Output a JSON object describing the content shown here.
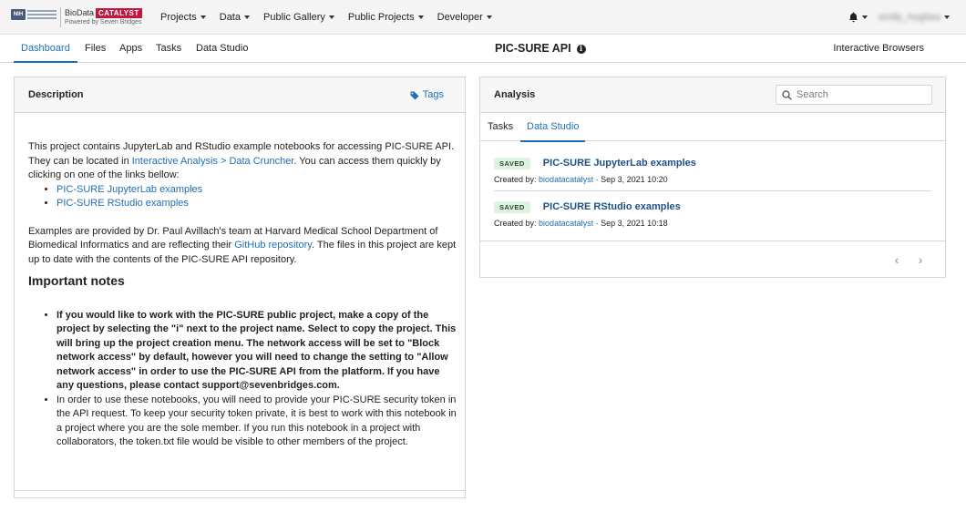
{
  "brand": {
    "nih": "NIH",
    "name_prefix": "BioData",
    "name_highlight": "CATALYST",
    "powered_by": "Powered by Seven Bridges"
  },
  "topnav": {
    "items": [
      "Projects",
      "Data",
      "Public Gallery",
      "Public Projects",
      "Developer"
    ],
    "username": "emily_hughes"
  },
  "subnav": {
    "tabs": [
      "Dashboard",
      "Files",
      "Apps",
      "Tasks",
      "Data Studio"
    ],
    "active_tab": "Dashboard",
    "page_title": "PIC-SURE API",
    "interactive_browsers": "Interactive Browsers"
  },
  "description": {
    "title": "Description",
    "tags_label": "Tags",
    "intro_pre": "This project contains JupyterLab and RStudio example notebooks for accessing PIC-SURE API. They can be located in ",
    "intro_link": "Interactive Analysis > Data Cruncher",
    "intro_post": ". You can access them quickly by clicking on one of the links bellow:",
    "links": [
      "PIC-SURE JupyterLab examples",
      "PIC-SURE RStudio examples"
    ],
    "para2_pre": "Examples are provided by Dr. Paul Avillach's team at Harvard Medical School Department of Biomedical Informatics and are reflecting their ",
    "para2_link": "GitHub repository",
    "para2_post": ". The files in this project are kept up to date with the contents of the PIC-SURE API repository.",
    "notes_heading": "Important notes",
    "note1": "If you would like to work with the PIC-SURE public project, make a copy of the project by selecting the \"i\" next to the project name. Select to copy the project. This will bring up the project creation menu. The network access will be set to \"Block network access\" by default, however you will need to change the setting to \"Allow network access\" in order to use the PIC-SURE API from the platform. If you have any questions, please contact support@sevenbridges.com.",
    "note2": "In order to use these notebooks, you will need to provide your PIC-SURE security token in the API request. To keep your security token private, it is best to work with this notebook in a project where you are the sole member. If you run this notebook in a project with collaborators, the token.txt file would be visible to other members of the project."
  },
  "analysis": {
    "title": "Analysis",
    "search_placeholder": "Search",
    "tabs": [
      "Tasks",
      "Data Studio"
    ],
    "active_tab": "Data Studio",
    "items": [
      {
        "status": "SAVED",
        "title": "PIC-SURE JupyterLab examples",
        "created_by_label": "Created by:",
        "creator": "biodatacatalyst",
        "date": "· Sep 3, 2021 10:20"
      },
      {
        "status": "SAVED",
        "title": "PIC-SURE RStudio examples",
        "created_by_label": "Created by:",
        "creator": "biodatacatalyst",
        "date": "· Sep 3, 2021 10:18"
      }
    ]
  },
  "colors": {
    "accent": "#1f6fb5",
    "brand_red": "#c0183e",
    "saved_badge_bg": "#dff2e1"
  }
}
